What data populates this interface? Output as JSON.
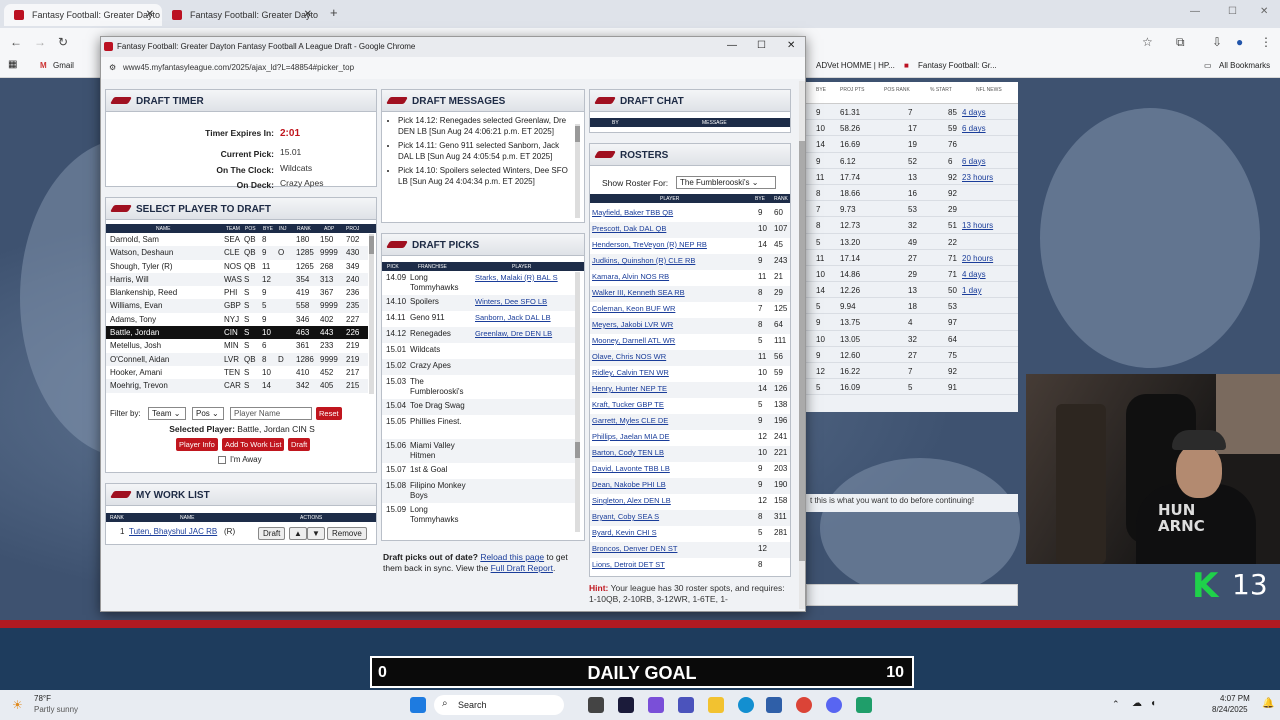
{
  "browser": {
    "tabs": [
      {
        "label": "Fantasy Football: Greater Dayto"
      },
      {
        "label": "Fantasy Football: Greater Dayto"
      }
    ],
    "bookmarks": [
      {
        "label": "Gmail"
      },
      {
        "label": "ADVet HOMME | HP..."
      },
      {
        "label": "Fantasy Football: Gr..."
      },
      {
        "label": "All Bookmarks"
      }
    ]
  },
  "popup": {
    "title": "Fantasy Football: Greater Dayton Fantasy Football A League Draft - Google Chrome",
    "url": "www45.myfantasyleague.com/2025/ajax_ld?L=48854#picker_top"
  },
  "timer": {
    "header": "DRAFT TIMER",
    "expires_label": "Timer Expires In:",
    "expires_value": "2:01",
    "current_pick_label": "Current Pick:",
    "current_pick_value": "15.01",
    "on_clock_label": "On The Clock:",
    "on_clock_value": "Wildcats",
    "on_deck_label": "On Deck:",
    "on_deck_value": "Crazy Apes"
  },
  "select_player": {
    "header": "SELECT PLAYER TO DRAFT",
    "columns": [
      "NAME",
      "TEAM",
      "POS",
      "BYE",
      "INJ",
      "RANK",
      "ADP",
      "PROJ"
    ],
    "rows": [
      {
        "name": "Darnold, Sam",
        "team": "SEA",
        "pos": "QB",
        "bye": "8",
        "inj": "",
        "rank": "180",
        "adp": "150",
        "proj": "702"
      },
      {
        "name": "Watson, Deshaun",
        "team": "CLE",
        "pos": "QB",
        "bye": "9",
        "inj": "O",
        "rank": "1285",
        "adp": "9999",
        "proj": "430"
      },
      {
        "name": "Shough, Tyler (R)",
        "team": "NOS",
        "pos": "QB",
        "bye": "11",
        "inj": "",
        "rank": "1265",
        "adp": "268",
        "proj": "349"
      },
      {
        "name": "Harris, Will",
        "team": "WAS",
        "pos": "S",
        "bye": "12",
        "inj": "",
        "rank": "354",
        "adp": "313",
        "proj": "240"
      },
      {
        "name": "Blankenship, Reed",
        "team": "PHI",
        "pos": "S",
        "bye": "9",
        "inj": "",
        "rank": "419",
        "adp": "367",
        "proj": "236"
      },
      {
        "name": "Williams, Evan",
        "team": "GBP",
        "pos": "S",
        "bye": "5",
        "inj": "",
        "rank": "558",
        "adp": "9999",
        "proj": "235"
      },
      {
        "name": "Adams, Tony",
        "team": "NYJ",
        "pos": "S",
        "bye": "9",
        "inj": "",
        "rank": "346",
        "adp": "402",
        "proj": "227"
      },
      {
        "name": "Battle, Jordan",
        "team": "CIN",
        "pos": "S",
        "bye": "10",
        "inj": "",
        "rank": "463",
        "adp": "443",
        "proj": "226"
      },
      {
        "name": "Metellus, Josh",
        "team": "MIN",
        "pos": "S",
        "bye": "6",
        "inj": "",
        "rank": "361",
        "adp": "233",
        "proj": "219"
      },
      {
        "name": "O'Connell, Aidan",
        "team": "LVR",
        "pos": "QB",
        "bye": "8",
        "inj": "D",
        "rank": "1286",
        "adp": "9999",
        "proj": "219"
      },
      {
        "name": "Hooker, Amani",
        "team": "TEN",
        "pos": "S",
        "bye": "10",
        "inj": "",
        "rank": "410",
        "adp": "452",
        "proj": "217"
      },
      {
        "name": "Moehrig, Trevon",
        "team": "CAR",
        "pos": "S",
        "bye": "14",
        "inj": "",
        "rank": "342",
        "adp": "405",
        "proj": "215"
      }
    ],
    "filter_label": "Filter by:",
    "team_select": "Team",
    "pos_select": "Pos",
    "name_placeholder": "Player Name",
    "reset": "Reset",
    "selected_label": "Selected Player:",
    "selected_value": "Battle, Jordan CIN S",
    "player_info": "Player Info",
    "add_worklist": "Add To Work List",
    "draft": "Draft",
    "away_label": "I'm Away"
  },
  "worklist": {
    "header": "MY WORK LIST",
    "columns": [
      "RANK",
      "NAME",
      "ACTIONS"
    ],
    "rank": "1",
    "name": "Tuten, Bhayshul JAC RB",
    "rookie": "(R)",
    "draft": "Draft",
    "up": "▲",
    "down": "▼",
    "remove": "Remove"
  },
  "messages": {
    "header": "DRAFT MESSAGES",
    "items": [
      "Pick 14.12: Renegades selected Greenlaw, Dre DEN LB [Sun Aug 24 4:06:21 p.m. ET 2025]",
      "Pick 14.11: Geno 911 selected Sanborn, Jack DAL LB [Sun Aug 24 4:05:54 p.m. ET 2025]",
      "Pick 14.10: Spoilers selected Winters, Dee SFO LB [Sun Aug 24 4:04:34 p.m. ET 2025]"
    ]
  },
  "picks": {
    "header": "DRAFT PICKS",
    "columns": [
      "PICK",
      "FRANCHISE",
      "PLAYER"
    ],
    "rows": [
      {
        "pick": "14.09",
        "franchise": "Long Tommyhawks",
        "player": "Starks, Malaki (R) BAL S"
      },
      {
        "pick": "14.10",
        "franchise": "Spoilers",
        "player": "Winters, Dee SFO LB"
      },
      {
        "pick": "14.11",
        "franchise": "Geno 911",
        "player": "Sanborn, Jack DAL LB"
      },
      {
        "pick": "14.12",
        "franchise": "Renegades",
        "player": "Greenlaw, Dre DEN LB"
      },
      {
        "pick": "15.01",
        "franchise": "Wildcats",
        "player": ""
      },
      {
        "pick": "15.02",
        "franchise": "Crazy Apes",
        "player": ""
      },
      {
        "pick": "15.03",
        "franchise": "The Fumblerooski's",
        "player": ""
      },
      {
        "pick": "15.04",
        "franchise": "Toe Drag Swag",
        "player": ""
      },
      {
        "pick": "15.05",
        "franchise": "Phillies Finest.",
        "player": ""
      },
      {
        "pick": "15.06",
        "franchise": "Miami Valley Hitmen",
        "player": ""
      },
      {
        "pick": "15.07",
        "franchise": "1st & Goal",
        "player": ""
      },
      {
        "pick": "15.08",
        "franchise": "Filipino Monkey Boys",
        "player": ""
      },
      {
        "pick": "15.09",
        "franchise": "Long Tommyhawks",
        "player": ""
      }
    ],
    "footer_text": "Draft picks out of date?",
    "reload_link": "Reload this page",
    "footer_mid": "to get them back in sync. View the",
    "full_report": "Full Draft Report",
    "footer_end": "."
  },
  "chat": {
    "header": "DRAFT CHAT",
    "columns": [
      "BY",
      "MESSAGE"
    ]
  },
  "rosters": {
    "header": "ROSTERS",
    "show_label": "Show Roster For:",
    "selected_team": "The Fumblerooski's",
    "columns": [
      "PLAYER",
      "BYE",
      "RANK"
    ],
    "rows": [
      {
        "player": "Mayfield, Baker TBB QB",
        "bye": "9",
        "rank": "60"
      },
      {
        "player": "Prescott, Dak DAL QB",
        "bye": "10",
        "rank": "107"
      },
      {
        "player": "Henderson, TreVeyon (R) NEP RB",
        "bye": "14",
        "rank": "45"
      },
      {
        "player": "Judkins, Quinshon (R) CLE RB",
        "bye": "9",
        "rank": "243"
      },
      {
        "player": "Kamara, Alvin NOS RB",
        "bye": "11",
        "rank": "21"
      },
      {
        "player": "Walker III, Kenneth SEA RB",
        "bye": "8",
        "rank": "29"
      },
      {
        "player": "Coleman, Keon BUF WR",
        "bye": "7",
        "rank": "125"
      },
      {
        "player": "Meyers, Jakobi LVR WR",
        "bye": "8",
        "rank": "64"
      },
      {
        "player": "Mooney, Darnell ATL WR",
        "bye": "5",
        "rank": "111"
      },
      {
        "player": "Olave, Chris NOS WR",
        "bye": "11",
        "rank": "56"
      },
      {
        "player": "Ridley, Calvin TEN WR",
        "bye": "10",
        "rank": "59"
      },
      {
        "player": "Henry, Hunter NEP TE",
        "bye": "14",
        "rank": "126"
      },
      {
        "player": "Kraft, Tucker GBP TE",
        "bye": "5",
        "rank": "138"
      },
      {
        "player": "Garrett, Myles CLE DE",
        "bye": "9",
        "rank": "196"
      },
      {
        "player": "Phillips, Jaelan MIA DE",
        "bye": "12",
        "rank": "241"
      },
      {
        "player": "Barton, Cody TEN LB",
        "bye": "10",
        "rank": "221"
      },
      {
        "player": "David, Lavonte TBB LB",
        "bye": "9",
        "rank": "203"
      },
      {
        "player": "Dean, Nakobe PHI LB",
        "bye": "9",
        "rank": "190"
      },
      {
        "player": "Singleton, Alex DEN LB",
        "bye": "12",
        "rank": "158"
      },
      {
        "player": "Bryant, Coby SEA S",
        "bye": "8",
        "rank": "311"
      },
      {
        "player": "Byard, Kevin CHI S",
        "bye": "5",
        "rank": "281"
      },
      {
        "player": "Broncos, Denver DEN ST",
        "bye": "12",
        "rank": ""
      },
      {
        "player": "Lions, Detroit DET ST",
        "bye": "8",
        "rank": ""
      }
    ],
    "hint_label": "Hint:",
    "hint_text": "Your league has 30 roster spots, and requires: 1-10QB, 2-10RB, 3-12WR, 1-6TE, 1-"
  },
  "background": {
    "columns": [
      "BYE",
      "PROJ PTS",
      "POS RANK",
      "% START",
      "NFL NEWS"
    ],
    "rows": [
      {
        "bye": "9",
        "proj": "61.31",
        "rank": "7",
        "start": "85",
        "news": "4 days"
      },
      {
        "bye": "10",
        "proj": "58.26",
        "rank": "17",
        "start": "59",
        "news": "6 days"
      },
      {
        "bye": "14",
        "proj": "16.69",
        "rank": "19",
        "start": "76",
        "news": ""
      },
      {
        "bye": "9",
        "proj": "6.12",
        "rank": "52",
        "start": "6",
        "news": "6 days"
      },
      {
        "bye": "11",
        "proj": "17.74",
        "rank": "13",
        "start": "92",
        "news": "23 hours"
      },
      {
        "bye": "8",
        "proj": "18.66",
        "rank": "16",
        "start": "92",
        "news": ""
      },
      {
        "bye": "7",
        "proj": "9.73",
        "rank": "53",
        "start": "29",
        "news": ""
      },
      {
        "bye": "8",
        "proj": "12.73",
        "rank": "32",
        "start": "51",
        "news": "13 hours"
      },
      {
        "bye": "5",
        "proj": "13.20",
        "rank": "49",
        "start": "22",
        "news": ""
      },
      {
        "bye": "11",
        "proj": "17.14",
        "rank": "27",
        "start": "71",
        "news": "20 hours"
      },
      {
        "bye": "10",
        "proj": "14.86",
        "rank": "29",
        "start": "71",
        "news": "4 days"
      },
      {
        "bye": "14",
        "proj": "12.26",
        "rank": "13",
        "start": "50",
        "news": "1 day"
      },
      {
        "bye": "5",
        "proj": "9.94",
        "rank": "18",
        "start": "53",
        "news": ""
      },
      {
        "bye": "9",
        "proj": "13.75",
        "rank": "4",
        "start": "97",
        "news": ""
      },
      {
        "bye": "10",
        "proj": "13.05",
        "rank": "32",
        "start": "64",
        "news": ""
      },
      {
        "bye": "9",
        "proj": "12.60",
        "rank": "27",
        "start": "75",
        "news": ""
      },
      {
        "bye": "12",
        "proj": "16.22",
        "rank": "7",
        "start": "92",
        "news": ""
      },
      {
        "bye": "5",
        "proj": "16.09",
        "rank": "5",
        "start": "91",
        "news": ""
      }
    ],
    "note": "t this is what you want to do before continuing!"
  },
  "overlay": {
    "goal_left": "0",
    "goal_label": "DAILY GOAL",
    "goal_right": "10",
    "k_letter": "K",
    "k_count": "13",
    "shirt_line1": "HUN",
    "shirt_line2": "ARNC"
  },
  "taskbar": {
    "temp": "78°F",
    "weather": "Partly sunny",
    "search": "Search",
    "time": "4:07 PM",
    "date": "8/24/2025"
  },
  "colors": {
    "accent_red": "#c0161e",
    "navy": "#1d2c48",
    "link": "#1a3d9a"
  }
}
